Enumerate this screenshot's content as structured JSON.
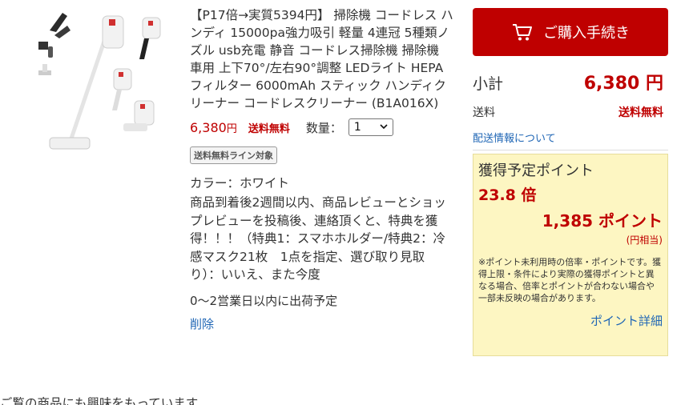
{
  "product": {
    "title": "【P17倍→実質5394円】 掃除機 コードレス ハンディ 15000pa強力吸引 軽量 4連冠 5種類ノズル usb充電 静音 コードレス掃除機 掃除機 車用 上下70°/左右90°調整 LEDライト HEPAフィルター 6000mAh スティック ハンディクリーナー コードレスクリーナー (B1A016X)",
    "price": "6,380",
    "price_unit": "円",
    "shipping_free": "送料無料",
    "qty_label": "数量：",
    "qty_value": "1",
    "badge": "送料無料ライン対象",
    "color_line": "カラー：ホワイト",
    "notice": "商品到着後2週間以内、商品レビューとショップレビューを投稿後、連絡頂くと、特典を獲得！！！（特典1：スマホホルダー/特典2：冷感マスク21枚　1点を指定、選び取り見取り）：いいえ、また今度",
    "ship_estimate": "0～2営業日以内に出荷予定",
    "delete_label": "削除"
  },
  "cart": {
    "buy_button": "ご購入手続き",
    "subtotal_label": "小計",
    "subtotal_value": "6,380 円",
    "shipping_label": "送料",
    "shipping_value": "送料無料",
    "shipping_info_link": "配送情報について"
  },
  "points": {
    "title": "獲得予定ポイント",
    "rate": "23.8 倍",
    "amount": "1,385 ポイント",
    "yen_equiv": "(円相当)",
    "note": "※ポイント未利用時の倍率・ポイントです。獲得上限・条件により実際の獲得ポイントと異なる場合、倍率とポイントが合わない場合や一部未反映の場合があります。",
    "detail_link": "ポイント詳細"
  },
  "bottom_text": "ご覧の商品にも興味をもっています",
  "icons": {
    "cart": "cart-icon",
    "chevron": "chevron-down-icon",
    "product_image": "vacuum-cleaner-image"
  },
  "colors": {
    "accent": "#bf0000",
    "link": "#1f66b5",
    "points_bg": "#fdf6c2"
  }
}
